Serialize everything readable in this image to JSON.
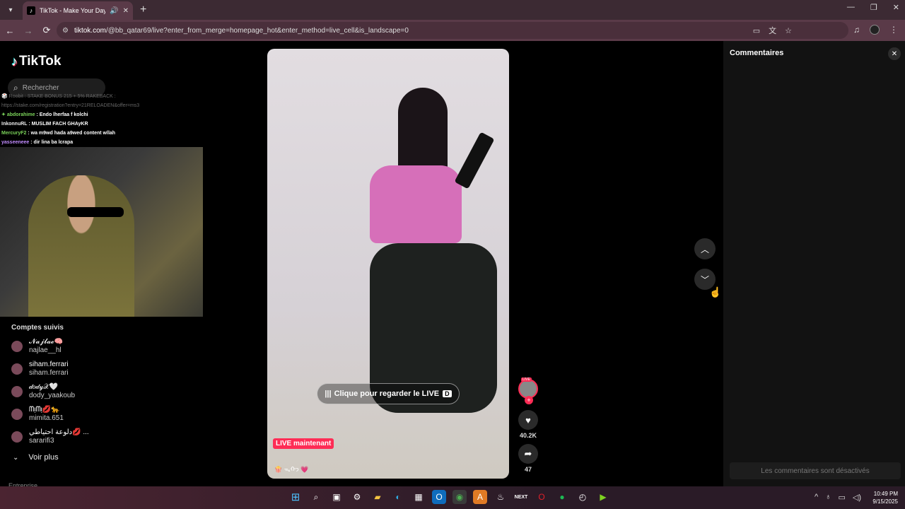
{
  "browser": {
    "tab_title": "TikTok - Make Your Day",
    "url_host": "tiktok.com",
    "url_path": "/@bb_qatar69/live?enter_from_merge=homepage_hot&enter_method=live_cell&is_landscape=0"
  },
  "tiktok": {
    "logo_text": "TikTok",
    "search_placeholder": "Rechercher",
    "chat": [
      {
        "user": "🎲 Roobit",
        "text": ": STAKE BONUS 215 + 5% RAKEBACK :",
        "faded": true
      },
      {
        "user": "",
        "text": "https://stake.com/registration?entry=21RELOADEN&offer=ms3",
        "faded": true
      },
      {
        "user": "abdorahime",
        "text": ": Endo lherfaa f kolchi"
      },
      {
        "user": "InkonnuRL",
        "text": ": MUSLIM FACH GHAyKR"
      },
      {
        "user": "MercuryF2",
        "text": ": wa m9wd hada a9wed content wllah"
      },
      {
        "user": "yasseeneee",
        "text": ": dir lina ba lcrapa"
      }
    ],
    "followed_title": "Comptes suivis",
    "followed": [
      {
        "display": "𝓝𝓪𝓳𝓵𝓪𝓮🧠",
        "handle": "najlae__hl"
      },
      {
        "display": "siham.ferrari",
        "handle": "siham.ferrari"
      },
      {
        "display": "𝒹𝑜𝒹𝓎𝒳🤍",
        "handle": "dody_yaakoub"
      },
      {
        "display": "ᗰᴉᗰᴉ💋🐆",
        "handle": "mimita.651"
      },
      {
        "display": "دلوعة احتياطي💋 ...",
        "handle": "sararifi3"
      }
    ],
    "see_more": "Voir plus",
    "cut_text": "Entreprise",
    "cta": "Clique pour regarder le LIVE",
    "cta_key": "D",
    "live_badge": "LIVE maintenant",
    "caption": "🍿 ᯓᡣ𐭩 💗",
    "likes": "40.2K",
    "shares": "47",
    "avatar_live": "LIVE",
    "comments_title": "Commentaires",
    "comments_disabled": "Les commentaires sont désactivés"
  },
  "taskbar": {
    "time": "10:49 PM",
    "date": "9/15/2025"
  },
  "colors": {
    "accent": "#fe2c55",
    "chrome": "#5a3a48"
  }
}
